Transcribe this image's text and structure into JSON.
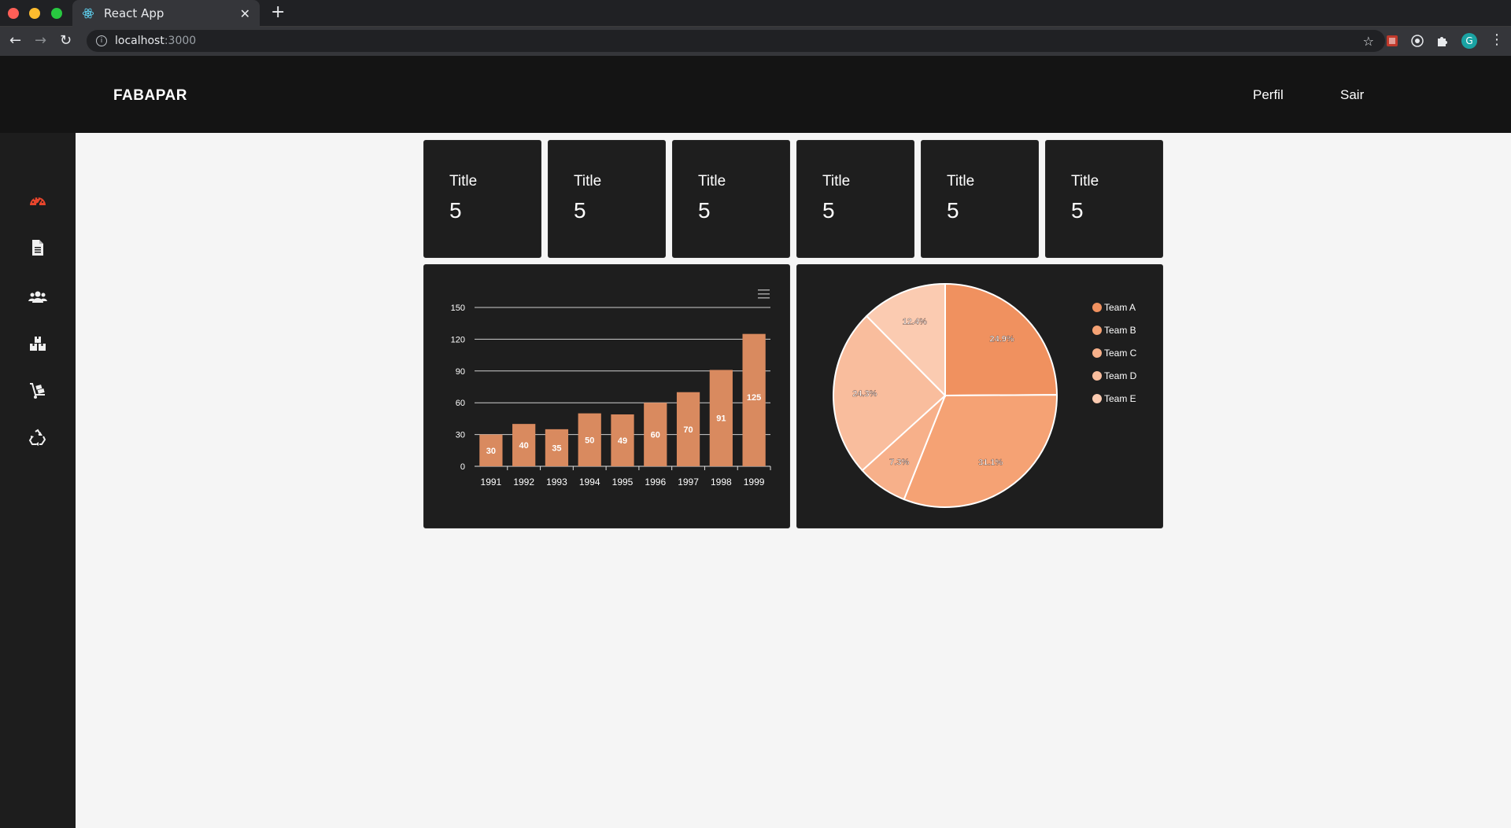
{
  "browser": {
    "tab_title": "React App",
    "url_host": "localhost",
    "url_port": ":3000",
    "avatar_letter": "G"
  },
  "header": {
    "brand": "FABAPAR",
    "nav": [
      {
        "label": "Perfil"
      },
      {
        "label": "Sair"
      }
    ]
  },
  "sidebar": {
    "items": [
      {
        "icon": "dashboard-icon",
        "active": true
      },
      {
        "icon": "document-icon"
      },
      {
        "icon": "users-icon"
      },
      {
        "icon": "boxes-icon"
      },
      {
        "icon": "hand-truck-icon"
      },
      {
        "icon": "recycle-icon"
      }
    ],
    "active_color": "#e8452c"
  },
  "cards": [
    {
      "title": "Title",
      "value": "5"
    },
    {
      "title": "Title",
      "value": "5"
    },
    {
      "title": "Title",
      "value": "5"
    },
    {
      "title": "Title",
      "value": "5"
    },
    {
      "title": "Title",
      "value": "5"
    },
    {
      "title": "Title",
      "value": "5"
    }
  ],
  "chart_data": [
    {
      "type": "bar",
      "categories": [
        "1991",
        "1992",
        "1993",
        "1994",
        "1995",
        "1996",
        "1997",
        "1998",
        "1999"
      ],
      "values": [
        30,
        40,
        35,
        50,
        49,
        60,
        70,
        91,
        125
      ],
      "ylim": [
        0,
        150
      ],
      "yticks": [
        "0",
        "30",
        "60",
        "90",
        "120",
        "150"
      ],
      "grid": true,
      "color": "#d98a5f",
      "data_labels": true,
      "menu_icon": "hamburger-menu-icon"
    },
    {
      "type": "pie",
      "series": [
        {
          "name": "Team A",
          "value": 24.9,
          "label": "24.9%",
          "color": "#f0915f"
        },
        {
          "name": "Team B",
          "value": 31.1,
          "label": "31.1%",
          "color": "#f5a274"
        },
        {
          "name": "Team C",
          "value": 7.3,
          "label": "7.3%",
          "color": "#f7b08a"
        },
        {
          "name": "Team D",
          "value": 24.3,
          "label": "24.3%",
          "color": "#f9bd9d"
        },
        {
          "name": "Team E",
          "value": 12.4,
          "label": "12.4%",
          "color": "#fbcbb1"
        }
      ],
      "legend_position": "right"
    }
  ]
}
